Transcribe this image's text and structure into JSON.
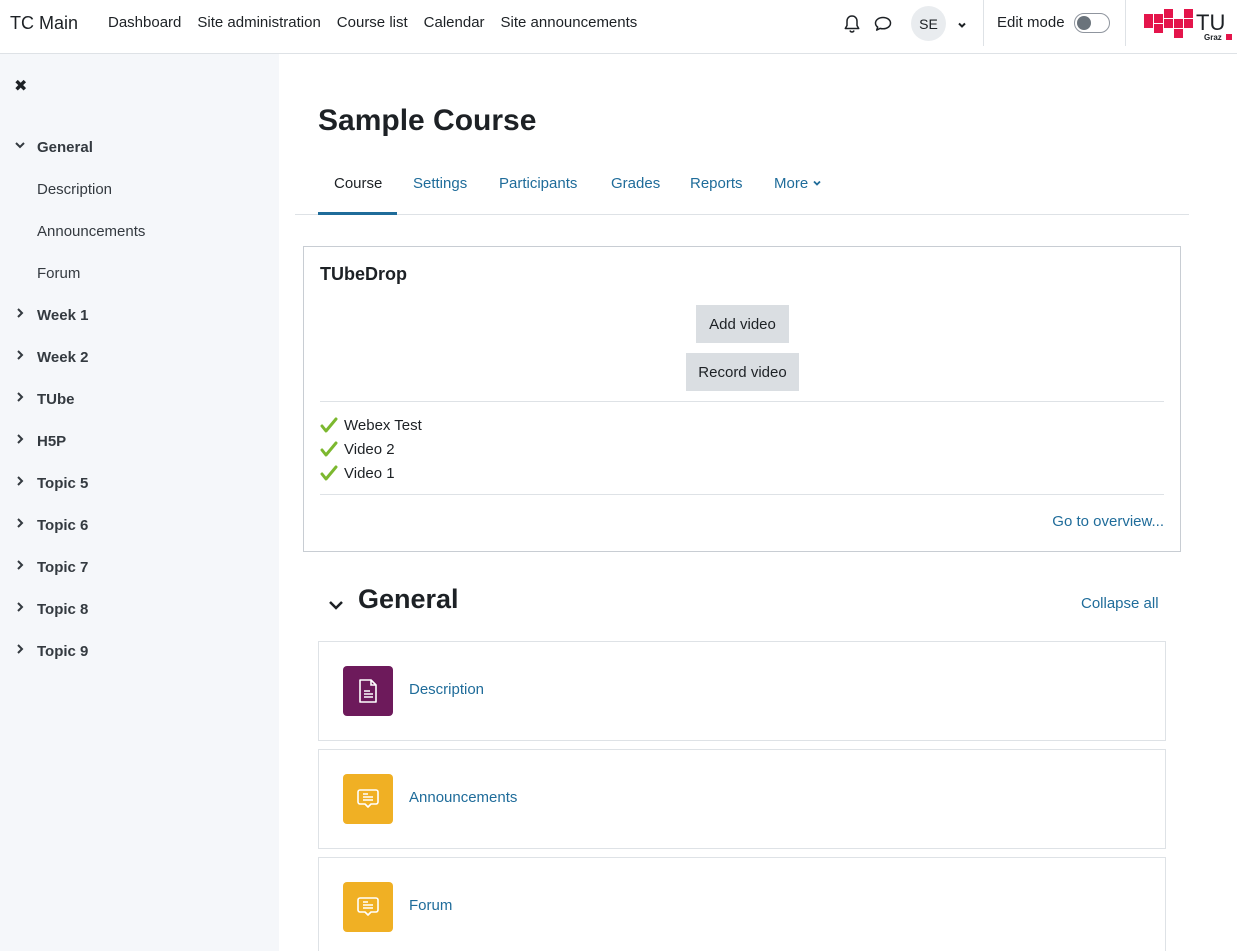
{
  "navbar": {
    "brand": "TC Main",
    "links": [
      "Dashboard",
      "Site administration",
      "Course list",
      "Calendar",
      "Site announcements"
    ],
    "notifications_icon": "bell-icon",
    "messages_icon": "chat-bubble-icon",
    "user_initials": "SE",
    "edit_mode_label": "Edit mode",
    "edit_mode_on": false,
    "logo_text": "TU",
    "logo_subtext": "Graz",
    "logo_color": "#e4154b"
  },
  "drawer": {
    "close_icon": "close-icon",
    "items": [
      {
        "label": "General",
        "type": "section",
        "expanded": true
      },
      {
        "label": "Description",
        "type": "sub"
      },
      {
        "label": "Announcements",
        "type": "sub"
      },
      {
        "label": "Forum",
        "type": "sub"
      },
      {
        "label": "Week 1",
        "type": "section",
        "expanded": false
      },
      {
        "label": "Week 2",
        "type": "section",
        "expanded": false
      },
      {
        "label": "TUbe",
        "type": "section",
        "expanded": false
      },
      {
        "label": "H5P",
        "type": "section",
        "expanded": false
      },
      {
        "label": "Topic 5",
        "type": "section",
        "expanded": false
      },
      {
        "label": "Topic 6",
        "type": "section",
        "expanded": false
      },
      {
        "label": "Topic 7",
        "type": "section",
        "expanded": false
      },
      {
        "label": "Topic 8",
        "type": "section",
        "expanded": false
      },
      {
        "label": "Topic 9",
        "type": "section",
        "expanded": false
      }
    ]
  },
  "main": {
    "title": "Sample Course",
    "tabs": [
      {
        "label": "Course",
        "active": true
      },
      {
        "label": "Settings"
      },
      {
        "label": "Participants"
      },
      {
        "label": "Grades"
      },
      {
        "label": "Reports"
      },
      {
        "label": "More"
      }
    ],
    "block": {
      "title": "TUbeDrop",
      "add_video": "Add video",
      "record_video": "Record video",
      "videos": [
        "Webex Test",
        "Video 2",
        "Video 1"
      ],
      "overview_link": "Go to overview..."
    },
    "section": {
      "title": "General",
      "collapse_all": "Collapse all",
      "activities": [
        {
          "name": "Description",
          "icon": "page-icon",
          "color": "#6d1a5b"
        },
        {
          "name": "Announcements",
          "icon": "forum-icon",
          "color": "#f0b024"
        },
        {
          "name": "Forum",
          "icon": "forum-icon",
          "color": "#f0b024"
        }
      ]
    }
  }
}
